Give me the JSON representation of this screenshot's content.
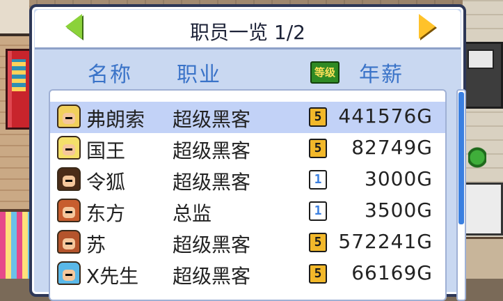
{
  "header": {
    "title": "职员一览 1/2",
    "prev_icon": "left-arrow-icon",
    "next_icon": "right-arrow-icon"
  },
  "columns": {
    "name": "名称",
    "job": "职业",
    "level": "等级",
    "salary": "年薪"
  },
  "staff": [
    {
      "name": "弗朗索",
      "job": "超级黑客",
      "level": "5",
      "salary": "441576G",
      "avatar_color": "#f1d05c",
      "selected": true
    },
    {
      "name": "国王",
      "job": "超级黑客",
      "level": "5",
      "salary": "82749G",
      "avatar_color": "#f4e06a",
      "selected": false
    },
    {
      "name": "令狐",
      "job": "超级黑客",
      "level": "1",
      "salary": "3000G",
      "avatar_color": "#4b2c18",
      "selected": false
    },
    {
      "name": "东方",
      "job": "总监",
      "level": "1",
      "salary": "3500G",
      "avatar_color": "#c75d2e",
      "selected": false
    },
    {
      "name": "苏",
      "job": "超级黑客",
      "level": "5",
      "salary": "572241G",
      "avatar_color": "#b4542c",
      "selected": false
    },
    {
      "name": "X先生",
      "job": "超级黑客",
      "level": "5",
      "salary": "66169G",
      "avatar_color": "#5ab8e8",
      "selected": false
    }
  ],
  "colors": {
    "panel_bg": "#c9d8f1",
    "header_text": "#3a73c8",
    "level5_bg": "#f2b82a",
    "level1_bg": "#3a7fe0",
    "selected_row": "#c2d2f7"
  }
}
